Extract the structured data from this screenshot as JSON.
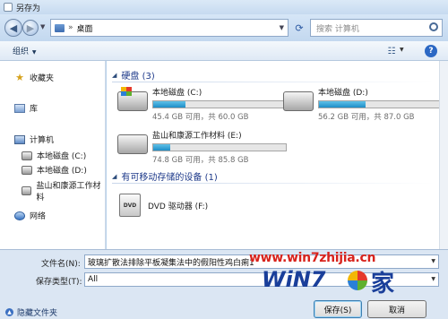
{
  "window": {
    "title": "另存为"
  },
  "address": {
    "path": "桌面",
    "search_placeholder": "搜索 计算机"
  },
  "toolbar": {
    "organize_label": "组织"
  },
  "sidebar": {
    "favorites": "收藏夹",
    "libraries": "库",
    "computer": "计算机",
    "drives": [
      "本地磁盘 (C:)",
      "本地磁盘 (D:)",
      "盐山和康源工作材料"
    ],
    "network": "网络"
  },
  "main": {
    "hard_disks_header": "硬盘 (3)",
    "removable_header": "有可移动存储的设备 (1)",
    "drives": [
      {
        "name": "本地磁盘 (C:)",
        "space": "45.4 GB 可用，共 60.0 GB",
        "used_fraction": 0.24
      },
      {
        "name": "本地磁盘 (D:)",
        "space": "56.2 GB 可用，共 87.0 GB",
        "used_fraction": 0.35
      },
      {
        "name": "盐山和康源工作材料 (E:)",
        "space": "74.8 GB 可用，共 85.8 GB",
        "used_fraction": 0.13
      }
    ],
    "dvd": {
      "name": "DVD 驱动器 (F:)",
      "icon_text": "DVD"
    }
  },
  "form": {
    "filename_label": "文件名(N):",
    "filename_value": "玻璃扩散法排除平板凝集法中的假阳性鸡白痢1",
    "type_label": "保存类型(T):",
    "type_value": "All",
    "hide_folders": "隐藏文件夹",
    "save_label": "保存(S)",
    "cancel_label": "取消"
  },
  "watermark": {
    "url": "www.win7zhijia.cn",
    "logo_text": "WiN7",
    "logo_suffix": "家"
  }
}
